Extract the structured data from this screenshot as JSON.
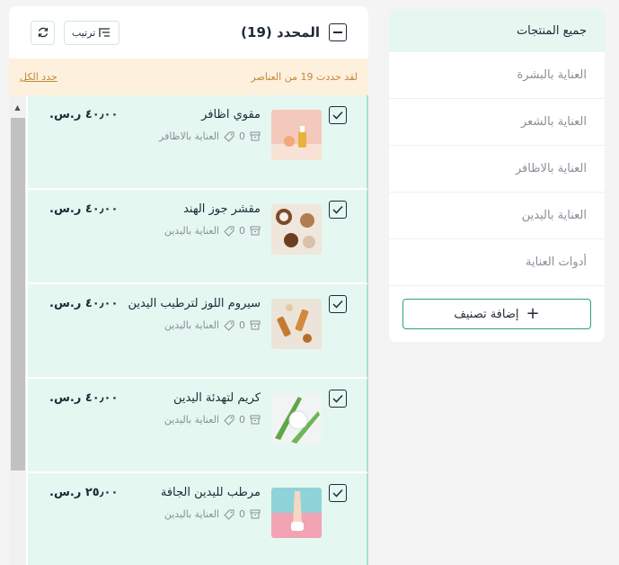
{
  "categories": {
    "items": [
      {
        "label": "جميع المنتجات",
        "active": true
      },
      {
        "label": "العناية بالبشرة",
        "active": false
      },
      {
        "label": "العناية بالشعر",
        "active": false
      },
      {
        "label": "العناية بالاظافر",
        "active": false
      },
      {
        "label": "العناية باليدين",
        "active": false
      },
      {
        "label": "أدوات العناية",
        "active": false
      }
    ],
    "add_label": "إضافة تصنيف"
  },
  "header": {
    "title": "المحدد (19)",
    "sort_label": "ترتيب"
  },
  "banner": {
    "text": "لقد حددت 19 من العناصر",
    "select_all": "حدد الكل"
  },
  "products": [
    {
      "name": "مقوي اظافر",
      "count": "0",
      "category": "العناية بالاظافر",
      "price": "٤٠٫٠٠ ر.س.",
      "checked": true
    },
    {
      "name": "مقشر جوز الهند",
      "count": "0",
      "category": "العناية باليدين",
      "price": "٤٠٫٠٠ ر.س.",
      "checked": true
    },
    {
      "name": "سيروم اللوز لترطيب اليدين",
      "count": "0",
      "category": "العناية باليدين",
      "price": "٤٠٫٠٠ ر.س.",
      "checked": true
    },
    {
      "name": "كريم لتهدئة اليدين",
      "count": "0",
      "category": "العناية باليدين",
      "price": "٤٠٫٠٠ ر.س.",
      "checked": true
    },
    {
      "name": "مرطب لليدين الجافة",
      "count": "0",
      "category": "العناية باليدين",
      "price": "٢٥٫٠٠ ر.س.",
      "checked": true
    }
  ],
  "colors": {
    "accent": "#2e9e86",
    "row_selected": "#e5f7f1",
    "banner_bg": "#fdf0dc",
    "banner_text": "#c08a3a"
  }
}
